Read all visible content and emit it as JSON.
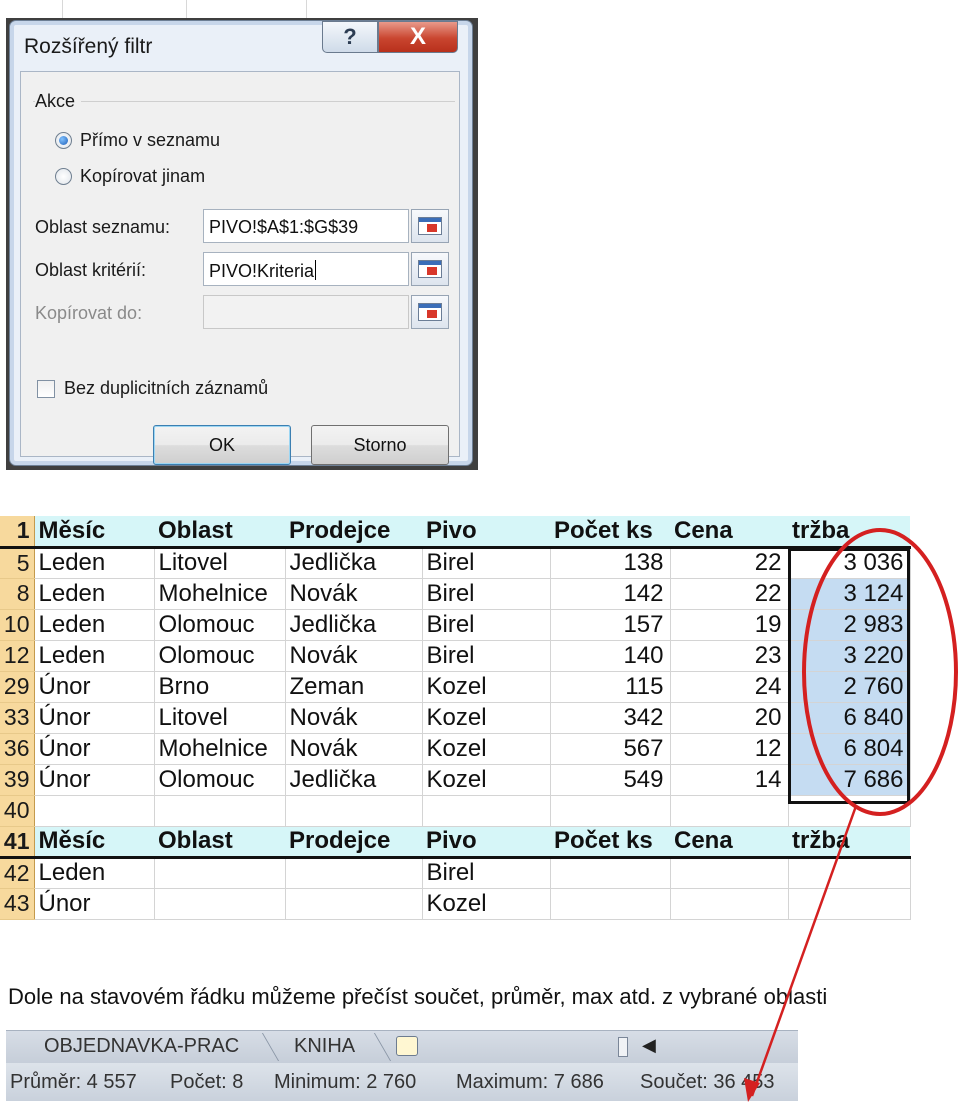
{
  "dialog": {
    "title": "Rozšířený filtr",
    "help_button": "?",
    "close_button": "X",
    "group_label": "Akce",
    "radio_in_place": "Přímo v seznamu",
    "radio_copy": "Kopírovat jinam",
    "list_range_label": "Oblast seznamu:",
    "list_range_value": "PIVO!$A$1:$G$39",
    "criteria_label": "Oblast kritérií:",
    "criteria_value": "PIVO!Kriteria",
    "copy_to_label": "Kopírovat do:",
    "copy_to_value": "",
    "unique_label": "Bez duplicitních záznamů",
    "ok_label": "OK",
    "cancel_label": "Storno"
  },
  "sheet": {
    "header_row_num": "1",
    "columns": [
      "Měsíc",
      "Oblast",
      "Prodejce",
      "Pivo",
      "Počet ks",
      "Cena",
      "tržba"
    ],
    "rows": [
      {
        "num": "5",
        "cells": [
          "Leden",
          "Litovel",
          "Jedlička",
          "Birel",
          "138",
          "22",
          "3 036"
        ]
      },
      {
        "num": "8",
        "cells": [
          "Leden",
          "Mohelnice",
          "Novák",
          "Birel",
          "142",
          "22",
          "3 124"
        ]
      },
      {
        "num": "10",
        "cells": [
          "Leden",
          "Olomouc",
          "Jedlička",
          "Birel",
          "157",
          "19",
          "2 983"
        ]
      },
      {
        "num": "12",
        "cells": [
          "Leden",
          "Olomouc",
          "Novák",
          "Birel",
          "140",
          "23",
          "3 220"
        ]
      },
      {
        "num": "29",
        "cells": [
          "Únor",
          "Brno",
          "Zeman",
          "Kozel",
          "115",
          "24",
          "2 760"
        ]
      },
      {
        "num": "33",
        "cells": [
          "Únor",
          "Litovel",
          "Novák",
          "Kozel",
          "342",
          "20",
          "6 840"
        ]
      },
      {
        "num": "36",
        "cells": [
          "Únor",
          "Mohelnice",
          "Novák",
          "Kozel",
          "567",
          "12",
          "6 804"
        ]
      },
      {
        "num": "39",
        "cells": [
          "Únor",
          "Olomouc",
          "Jedlička",
          "Kozel",
          "549",
          "14",
          "7 686"
        ]
      }
    ],
    "empty_row_num": "40",
    "criteria_header_num": "41",
    "criteria_columns": [
      "Měsíc",
      "Oblast",
      "Prodejce",
      "Pivo",
      "Počet ks",
      "Cena",
      "tržba"
    ],
    "criteria_rows": [
      {
        "num": "42",
        "cells": [
          "Leden",
          "",
          "",
          "Birel",
          "",
          "",
          ""
        ]
      },
      {
        "num": "43",
        "cells": [
          "Únor",
          "",
          "",
          "Kozel",
          "",
          "",
          ""
        ]
      }
    ]
  },
  "caption": "Dole na stavovém řádku můžeme přečíst součet, průměr, max atd. z vybrané oblasti",
  "tabs": {
    "tab1": "OBJEDNAVKA-PRAC",
    "tab2": "KNIHA"
  },
  "status": {
    "average": "Průměr: 4 557",
    "count": "Počet: 8",
    "minimum": "Minimum: 2 760",
    "maximum": "Maximum: 7 686",
    "sum": "Součet: 36 453"
  },
  "annotation_color": "#d42020",
  "icons": [
    "help-icon",
    "close-icon",
    "range-picker-icon",
    "new-sheet-icon",
    "scroll-left-icon"
  ]
}
